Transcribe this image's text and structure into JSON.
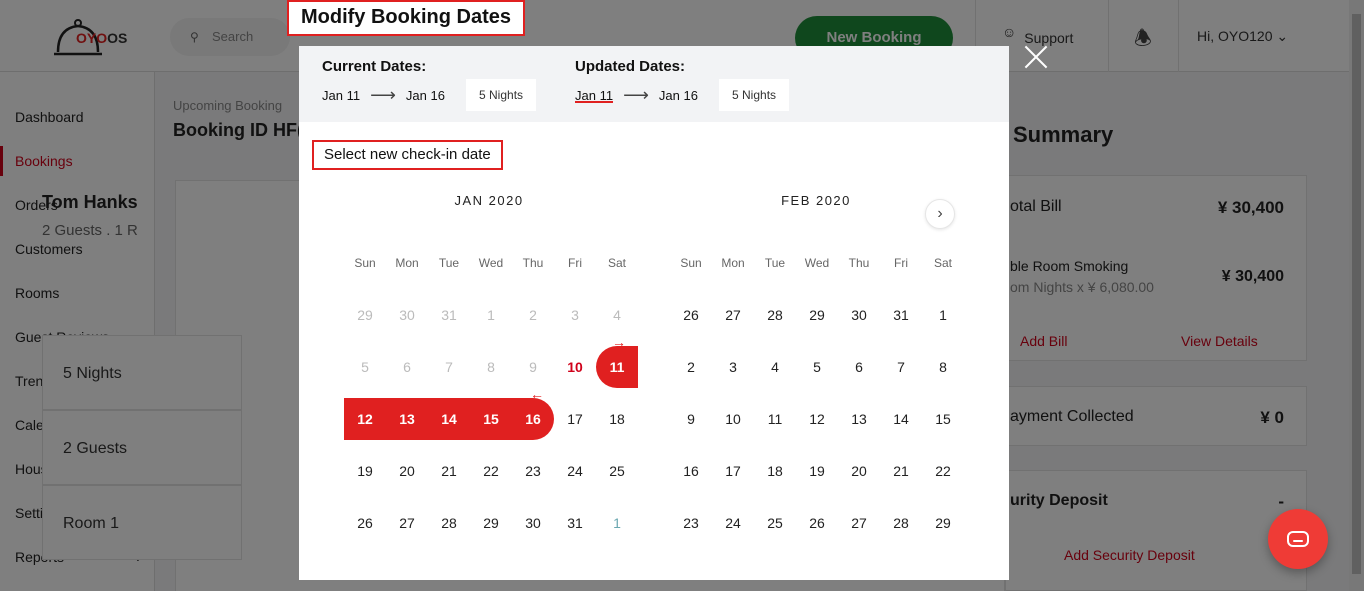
{
  "app": {
    "logo_text": "OYO",
    "logo_suffix": "OS",
    "search_placeholder": "Search",
    "new_booking_label": "New Booking",
    "support_label": "Support",
    "user_label": "Hi, OYO120 ⌄"
  },
  "sidebar": {
    "items": [
      {
        "label": "Dashboard"
      },
      {
        "label": "Bookings"
      },
      {
        "label": "Orders"
      },
      {
        "label": "Customers"
      },
      {
        "label": "Rooms"
      },
      {
        "label": "Guest Reviews"
      },
      {
        "label": "Trends"
      },
      {
        "label": "Calendar"
      },
      {
        "label": "House Keeping"
      },
      {
        "label": "Settings"
      },
      {
        "label": "Reports"
      }
    ]
  },
  "main": {
    "breadcrumb": "Upcoming Booking",
    "booking_id": "Booking ID HF(",
    "guest_name": "Tom Hanks",
    "guest_sub": "2 Guests . 1 R",
    "info": [
      "5 Nights",
      "2 Guests",
      "Room 1"
    ]
  },
  "summary": {
    "title": "Summary",
    "total_bill_label": "otal Bill",
    "total_bill_value": "¥ 30,400",
    "room_label": "ble Room Smoking",
    "room_sub": "om Nights x ¥ 6,080.00",
    "room_value": "¥ 30,400",
    "add_bill": "Add Bill",
    "view_details": "View Details",
    "payment_label": "ayment Collected",
    "payment_value": "¥ 0",
    "deposit_label": "urity Deposit",
    "deposit_value": "-",
    "add_deposit": "Add Security Deposit"
  },
  "modal": {
    "title": "Modify Booking Dates",
    "current_label": "Current Dates:",
    "current_from": "Jan 11",
    "current_to": "Jan 16",
    "current_nights": "5 Nights",
    "updated_label": "Updated Dates:",
    "updated_from": "Jan 11",
    "updated_to": "Jan 16",
    "updated_nights": "5 Nights",
    "select_label": "Select new check-in date",
    "weekdays": [
      "Sun",
      "Mon",
      "Tue",
      "Wed",
      "Thu",
      "Fri",
      "Sat"
    ],
    "months": [
      {
        "title": "JAN 2020",
        "weeks": [
          [
            {
              "d": "29",
              "s": "dim"
            },
            {
              "d": "30",
              "s": "dim"
            },
            {
              "d": "31",
              "s": "dim"
            },
            {
              "d": "1",
              "s": "dim"
            },
            {
              "d": "2",
              "s": "dim"
            },
            {
              "d": "3",
              "s": "dim"
            },
            {
              "d": "4",
              "s": "dim"
            }
          ],
          [
            {
              "d": "5",
              "s": "dim"
            },
            {
              "d": "6",
              "s": "dim"
            },
            {
              "d": "7",
              "s": "dim"
            },
            {
              "d": "8",
              "s": "dim"
            },
            {
              "d": "9",
              "s": "dim"
            },
            {
              "d": "10",
              "s": "today"
            },
            {
              "d": "11",
              "s": "sel-start"
            }
          ],
          [
            {
              "d": "12",
              "s": "sel"
            },
            {
              "d": "13",
              "s": "sel"
            },
            {
              "d": "14",
              "s": "sel"
            },
            {
              "d": "15",
              "s": "sel"
            },
            {
              "d": "16",
              "s": "sel-end"
            },
            {
              "d": "17",
              "s": ""
            },
            {
              "d": "18",
              "s": ""
            }
          ],
          [
            {
              "d": "19",
              "s": ""
            },
            {
              "d": "20",
              "s": ""
            },
            {
              "d": "21",
              "s": ""
            },
            {
              "d": "22",
              "s": ""
            },
            {
              "d": "23",
              "s": ""
            },
            {
              "d": "24",
              "s": ""
            },
            {
              "d": "25",
              "s": ""
            }
          ],
          [
            {
              "d": "26",
              "s": ""
            },
            {
              "d": "27",
              "s": ""
            },
            {
              "d": "28",
              "s": ""
            },
            {
              "d": "29",
              "s": ""
            },
            {
              "d": "30",
              "s": ""
            },
            {
              "d": "31",
              "s": ""
            },
            {
              "d": "1",
              "s": "next-month"
            }
          ]
        ]
      },
      {
        "title": "FEB 2020",
        "weeks": [
          [
            {
              "d": "26",
              "s": ""
            },
            {
              "d": "27",
              "s": ""
            },
            {
              "d": "28",
              "s": ""
            },
            {
              "d": "29",
              "s": ""
            },
            {
              "d": "30",
              "s": ""
            },
            {
              "d": "31",
              "s": ""
            },
            {
              "d": "1",
              "s": ""
            }
          ],
          [
            {
              "d": "2",
              "s": ""
            },
            {
              "d": "3",
              "s": ""
            },
            {
              "d": "4",
              "s": ""
            },
            {
              "d": "5",
              "s": ""
            },
            {
              "d": "6",
              "s": ""
            },
            {
              "d": "7",
              "s": ""
            },
            {
              "d": "8",
              "s": ""
            }
          ],
          [
            {
              "d": "9",
              "s": ""
            },
            {
              "d": "10",
              "s": ""
            },
            {
              "d": "11",
              "s": ""
            },
            {
              "d": "12",
              "s": ""
            },
            {
              "d": "13",
              "s": ""
            },
            {
              "d": "14",
              "s": ""
            },
            {
              "d": "15",
              "s": ""
            }
          ],
          [
            {
              "d": "16",
              "s": ""
            },
            {
              "d": "17",
              "s": ""
            },
            {
              "d": "18",
              "s": ""
            },
            {
              "d": "19",
              "s": ""
            },
            {
              "d": "20",
              "s": ""
            },
            {
              "d": "21",
              "s": ""
            },
            {
              "d": "22",
              "s": ""
            }
          ],
          [
            {
              "d": "23",
              "s": ""
            },
            {
              "d": "24",
              "s": ""
            },
            {
              "d": "25",
              "s": ""
            },
            {
              "d": "26",
              "s": ""
            },
            {
              "d": "27",
              "s": ""
            },
            {
              "d": "28",
              "s": ""
            },
            {
              "d": "29",
              "s": ""
            }
          ]
        ]
      }
    ],
    "checkin_marker": "→",
    "checkout_marker": "←"
  },
  "colors": {
    "accent": "#e02020",
    "brand_green": "#1f8f3a",
    "active_nav": "#d0021b"
  }
}
